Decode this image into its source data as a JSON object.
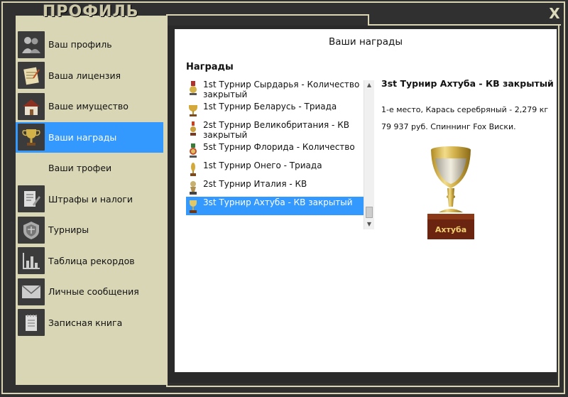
{
  "app": {
    "title": "ПРОФИЛЬ",
    "close_label": "X"
  },
  "sidebar": {
    "items": [
      {
        "label": "Ваш профиль",
        "icon": "users-icon",
        "active": false
      },
      {
        "label": "Ваша лицензия",
        "icon": "license-icon",
        "active": false
      },
      {
        "label": "Ваше имущество",
        "icon": "house-icon",
        "active": false
      },
      {
        "label": "Ваши награды",
        "icon": "trophy-icon",
        "active": true
      },
      {
        "label": "Ваши трофеи",
        "icon": "",
        "active": false
      },
      {
        "label": "Штрафы и налоги",
        "icon": "document-edit-icon",
        "active": false
      },
      {
        "label": "Турниры",
        "icon": "tournament-badge-icon",
        "active": false
      },
      {
        "label": "Таблица рекордов",
        "icon": "bar-chart-icon",
        "active": false
      },
      {
        "label": "Личные сообщения",
        "icon": "envelope-icon",
        "active": false
      },
      {
        "label": "Записная книга",
        "icon": "notepad-icon",
        "active": false
      }
    ]
  },
  "main": {
    "title": "Ваши награды",
    "section_label": "Награды",
    "awards": [
      {
        "label": "1st Турнир Сырдарья - Количество закрытый",
        "icon": "medal-icon"
      },
      {
        "label": "1st Турнир Беларусь - Триада",
        "icon": "cup-icon"
      },
      {
        "label": "2st Турнир Великобритания - КВ закрытый",
        "icon": "medal-icon"
      },
      {
        "label": "5st Турнир Флорида - Количество",
        "icon": "medal-icon"
      },
      {
        "label": "1st Турнир Онего - Триада",
        "icon": "medal-icon"
      },
      {
        "label": "2st Турнир Италия - КВ",
        "icon": "medal-icon"
      },
      {
        "label": "3st Турнир Ахтуба - КВ закрытый",
        "icon": "cup-icon",
        "selected": true
      }
    ],
    "detail": {
      "title": "3st Турнир Ахтуба - КВ закрытый",
      "line1": "1-е место, Карась серебряный - 2,279 кг",
      "line2": "79 937 руб. Спиннинг Fox Виски.",
      "trophy_label": "Ахтуба"
    }
  },
  "colors": {
    "accent": "#3399ff",
    "panel": "#d9d6b6",
    "frame": "#303030"
  }
}
